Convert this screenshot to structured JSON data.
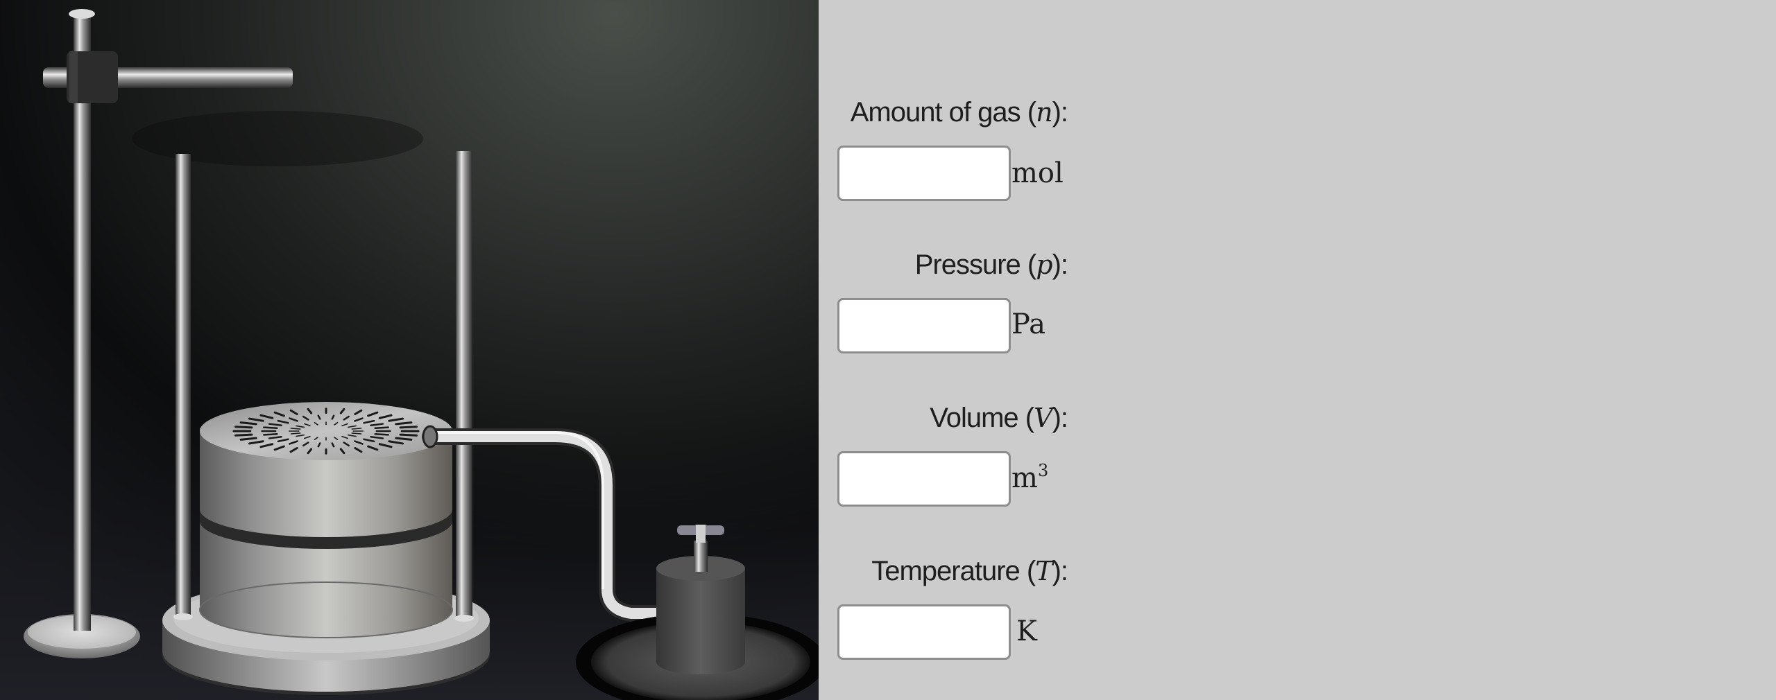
{
  "simulation": {
    "apparatus": [
      "stand-rod",
      "cross-bar",
      "guide-rod-left",
      "guide-rod-right",
      "gas-cylinder",
      "piston-lid",
      "base-plate",
      "connecting-tube",
      "valve-container",
      "valve-handle"
    ]
  },
  "fields": [
    {
      "label": "Amount of gas",
      "symbol": "n",
      "suffix": "):",
      "unit": "mol",
      "unit_sup": "",
      "value": "",
      "placeholder": ""
    },
    {
      "label": "Pressure",
      "symbol": "p",
      "suffix": "):",
      "unit": "Pa",
      "unit_sup": "",
      "value": "",
      "placeholder": ""
    },
    {
      "label": "Volume",
      "symbol": "V",
      "suffix": "):",
      "unit": "m",
      "unit_sup": "3",
      "value": "",
      "placeholder": ""
    },
    {
      "label": "Temperature",
      "symbol": "T",
      "suffix": "):",
      "unit": "K",
      "unit_sup": "",
      "value": "",
      "placeholder": ""
    }
  ]
}
